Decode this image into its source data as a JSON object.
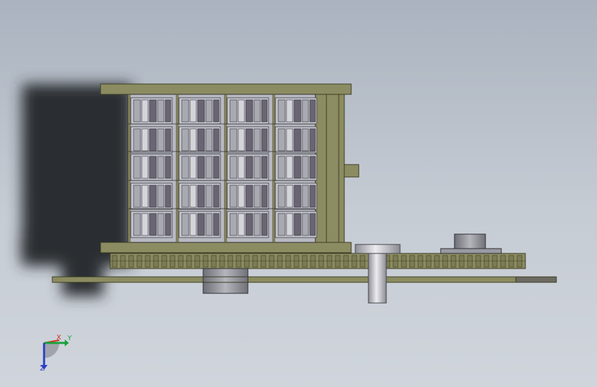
{
  "viewport": {
    "background_top": "#aab3bf",
    "background_bottom": "#d0d5dc"
  },
  "model": {
    "frame_color": "#8c8c62",
    "frame_edge": "#3b3b22",
    "panel_color": "#9a9aa3",
    "panel_dark": "#6b6573",
    "shaft_color": "#c9c9cf",
    "shadow_color": "#2a2d31"
  },
  "triad": {
    "x_label": "X",
    "y_label": "Y",
    "z_label": "Z",
    "x_color": "#d0301c",
    "y_color": "#18a23a",
    "z_color": "#2a3fc8"
  }
}
